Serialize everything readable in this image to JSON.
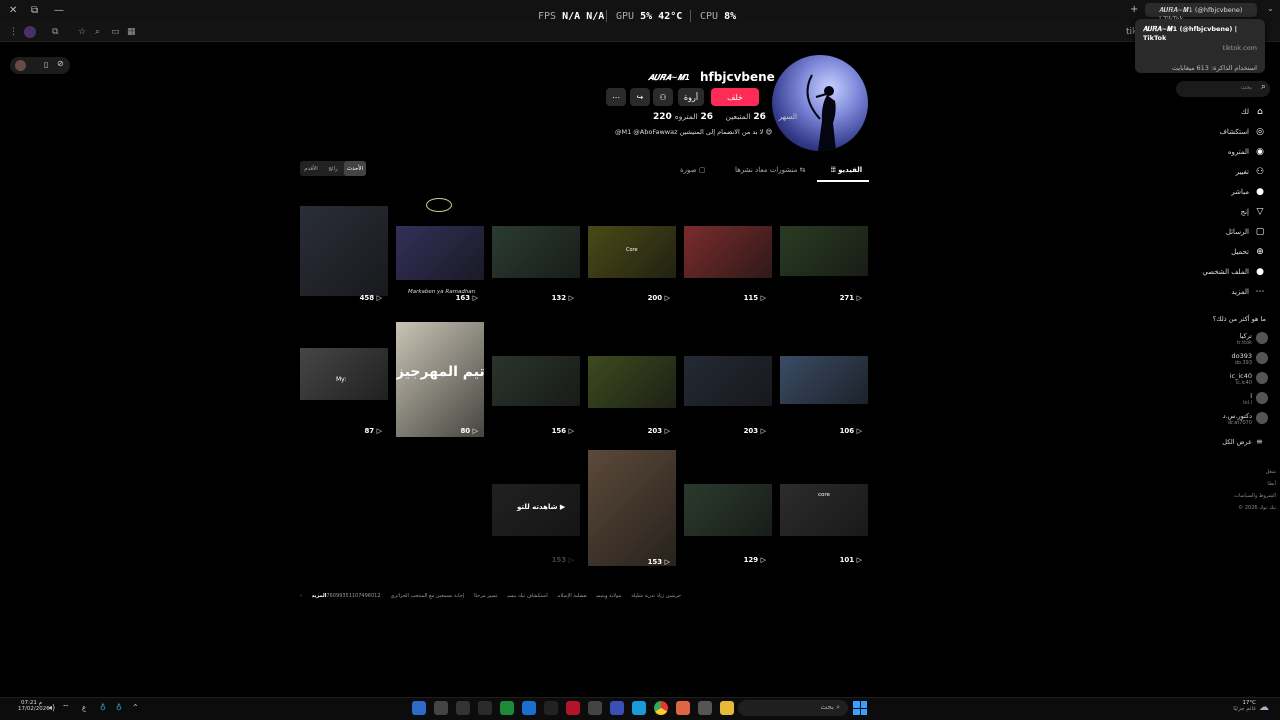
{
  "window": {
    "close": "✕",
    "restore": "⧉",
    "minimize": "—"
  },
  "hud": {
    "fps_label": "FPS",
    "fps_val": "N/A",
    "fps_val2": "N/A",
    "gpu_label": "GPU",
    "gpu_val": "5%",
    "gpu_temp": "42°C",
    "cpu_label": "CPU",
    "cpu_val": "8%"
  },
  "browser": {
    "tab_title": "𝑨𝑼𝑹𝑨~𝑴1 (@hfbjcvbene) | TikTok",
    "address_hint": "tikt"
  },
  "tab_tooltip": {
    "title": "𝑨𝑼𝑹𝑨~𝑴1 (@hfbjcvbene) | TikTok",
    "domain": "tiktok.com",
    "memory": "استخدام الذاكرة: 613 ميغابايت"
  },
  "profile": {
    "username": "hfbjcvbene",
    "nickname": "𝑨𝑼𝑹𝑨~𝑴1",
    "follow_label": "خلف",
    "friend_label": "أروة",
    "stats": [
      {
        "value": "26",
        "label": "المتروه"
      },
      {
        "value": "26",
        "label": "المتبعين"
      },
      {
        "value": "220",
        "label": "السهر"
      }
    ],
    "bio": "@M1 @AboFawwaz لا بد من الانضمام إلى المتيشين 😄"
  },
  "tabs": [
    {
      "label": "الفيديو"
    },
    {
      "label": "منشورات معاد نشرها"
    },
    {
      "label": "صورة"
    }
  ],
  "sort": [
    {
      "label": "الأحدث"
    },
    {
      "label": "رائج"
    },
    {
      "label": "الأقدم"
    }
  ],
  "videos": [
    {
      "views": "271",
      "thumb": "#2a3b22"
    },
    {
      "views": "115",
      "thumb": "#7a2c2c"
    },
    {
      "views": "200",
      "thumb": "#4a4a16"
    },
    {
      "views": "132",
      "thumb": "#2b3b31"
    },
    {
      "views": "163",
      "thumb": "#33305a"
    },
    {
      "views": "458",
      "thumb": "#2a2e38"
    },
    {
      "views": "106",
      "thumb": "#3a4c66"
    },
    {
      "views": "203",
      "thumb": "#242a34"
    },
    {
      "views": "203",
      "thumb": "#3d4a1e"
    },
    {
      "views": "156",
      "thumb": "#2a342c"
    },
    {
      "views": "80",
      "thumb": "#c9c4b5"
    },
    {
      "views": "87",
      "thumb": "#464646"
    },
    {
      "views": "101",
      "thumb": "#2c2c2c"
    },
    {
      "views": "129",
      "thumb": "#2b3a2d"
    },
    {
      "views": "153",
      "thumb": "#5c4a3a"
    },
    {
      "views": "153",
      "thumb": "#202020"
    }
  ],
  "overlays": {
    "watch_again": "شاهدته للتو",
    "core1": "Core",
    "core2": "core",
    "ramadan": "Markaben ya Ramadhan",
    "big_text": "يات تيم المهرجيز",
    "my": "My:"
  },
  "sidebar": {
    "search_placeholder": "بحث",
    "nav": [
      {
        "label": "لك",
        "icon": "⌂"
      },
      {
        "label": "استكشاف",
        "icon": "◎"
      },
      {
        "label": "المتروه",
        "icon": "◉"
      },
      {
        "label": "تغيير",
        "icon": "⚇"
      },
      {
        "label": "مباشر",
        "icon": "●"
      },
      {
        "label": "إنج",
        "icon": "▽"
      },
      {
        "label": "الرسائل",
        "icon": "▢"
      },
      {
        "label": "تحميل",
        "icon": "⊕"
      },
      {
        "label": "الملف الشخصي",
        "icon": "●"
      },
      {
        "label": "المزيد",
        "icon": "⋯"
      }
    ],
    "suggest_title": "ما هو أكثر من ذلك؟",
    "suggestions": [
      {
        "name": "تركيا",
        "handle": "tr.ttok"
      },
      {
        "name": "do393",
        "handle": "do.393"
      },
      {
        "name": "ic_ic40",
        "handle": "ic.ic40"
      },
      {
        "name": "l",
        "handle": "lol.l"
      },
      {
        "name": "دكتور.س.د",
        "handle": "dr.at7070"
      }
    ],
    "see_all": "عرض الكل",
    "footer": [
      "شغل",
      "أيضًا",
      "الشروط والسياسات",
      "© 2026 تيك توك"
    ]
  },
  "related": {
    "more_label": "المزيد",
    "items": [
      "76099351107496012",
      "إجابة تسمعين مع المنتخب الجزائري",
      "تمييز مرحبًا",
      "استكشاف تيك بيسي",
      "فشلية الإسلام",
      "مولاية ويتيمي",
      "حرسين زياد تدرية شليلة"
    ]
  },
  "taskbar": {
    "search": "بحث",
    "weather_temp": "17°C",
    "weather_text": "غائم جزئيًا",
    "time": "07:21 م",
    "date": "17/02/2026",
    "lang": "ع"
  }
}
